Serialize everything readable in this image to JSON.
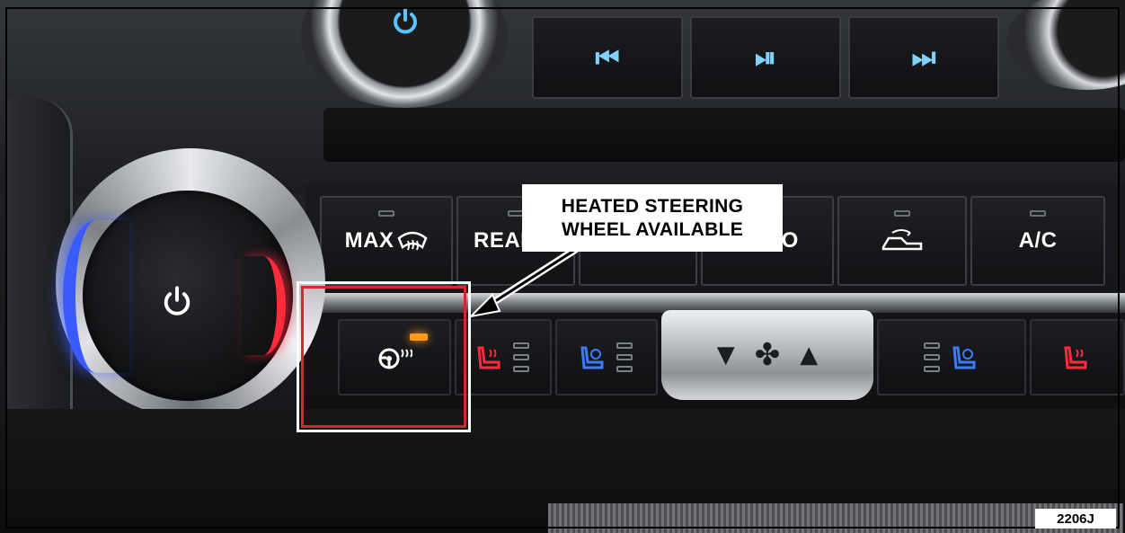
{
  "photo": {
    "media_controls": [
      {
        "name": "previous-track",
        "glyph": "⏮"
      },
      {
        "name": "play-pause",
        "glyph": "⏯"
      },
      {
        "name": "next-track",
        "glyph": "⏭"
      }
    ],
    "climate_buttons": [
      {
        "name": "max-defrost",
        "label": "MAX",
        "icon": "defrost-icon"
      },
      {
        "name": "rear-defrost",
        "label": "REAR",
        "icon": "rear-defrost-icon"
      },
      {
        "name": "recirculation",
        "label": "",
        "icon": "recirculation-icon"
      },
      {
        "name": "auto",
        "label": "AUTO",
        "icon": ""
      },
      {
        "name": "fresh-air",
        "label": "",
        "icon": "vehicle-airflow-icon"
      },
      {
        "name": "ac",
        "label": "A/C",
        "icon": ""
      }
    ],
    "seat_controls": [
      {
        "name": "heated-steering-wheel",
        "icon": "heated-steering-wheel-icon",
        "indicator": "on"
      },
      {
        "name": "driver-heated-seat",
        "icon": "heated-seat-icon"
      },
      {
        "name": "driver-cooled-seat",
        "icon": "cooled-seat-icon"
      },
      {
        "name": "passenger-cooled-seat",
        "icon": "cooled-seat-icon"
      },
      {
        "name": "passenger-heated-seat",
        "icon": "heated-seat-icon"
      }
    ],
    "colors": {
      "led_amber": "#ff9a1f",
      "heat_red": "#ff2a3a",
      "cool_blue": "#3a7bff",
      "icon_cyan": "#7fd1ff",
      "highlight_red": "#d8262e"
    }
  },
  "annotation": {
    "callout_line1": "HEATED STEERING",
    "callout_line2": "WHEEL AVAILABLE"
  },
  "figure_code": "2206J"
}
